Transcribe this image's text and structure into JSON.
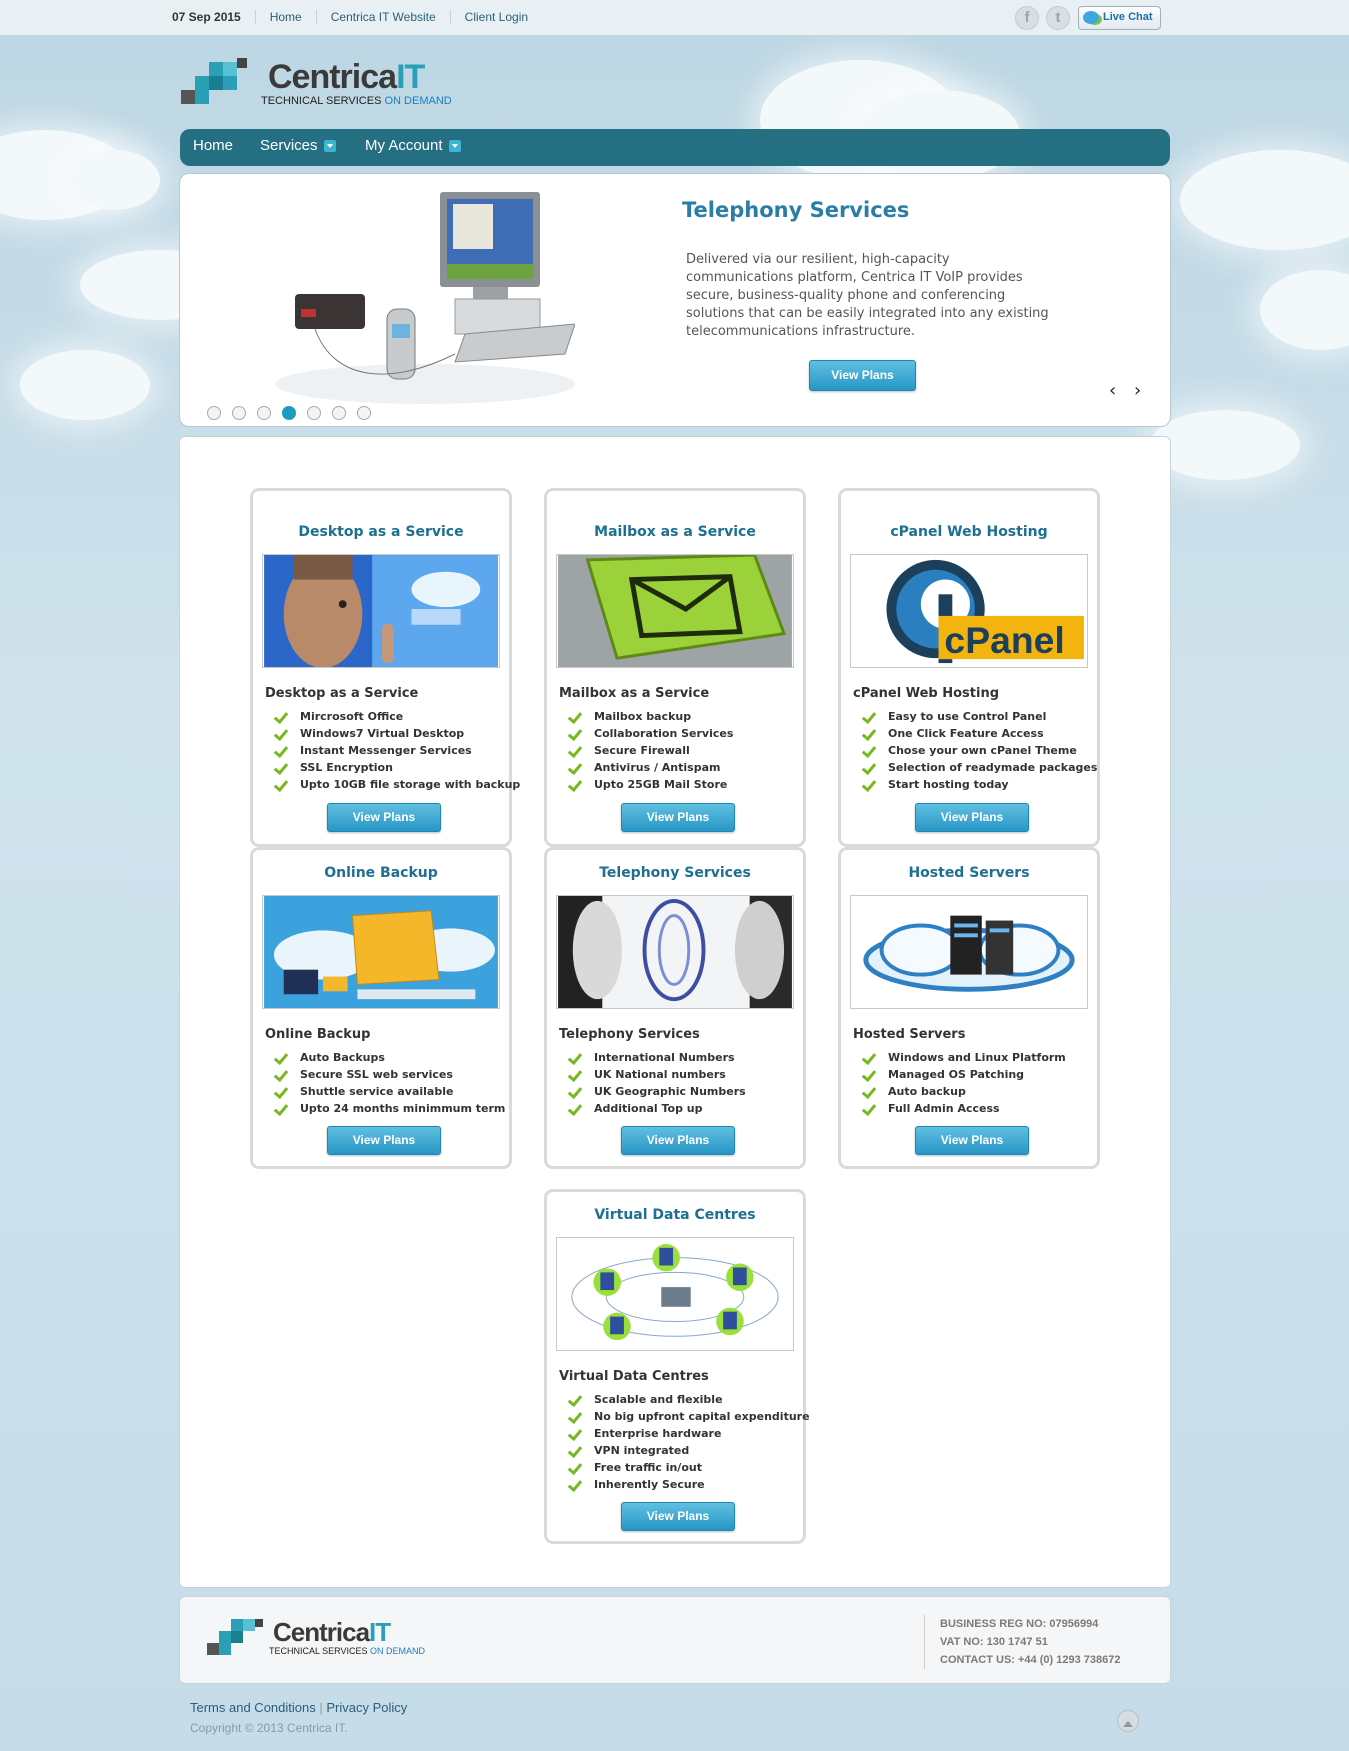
{
  "topbar": {
    "date": "07 Sep 2015",
    "links": [
      "Home",
      "Centrica IT Website",
      "Client Login"
    ],
    "social_icons": [
      "facebook-icon",
      "twitter-icon"
    ],
    "live_chat": "Live Chat"
  },
  "logo": {
    "brand_main": "Centrica",
    "brand_accent": "IT",
    "tagline_main": "TECHNICAL SERVICES",
    "tagline_accent": "ON DEMAND"
  },
  "nav": {
    "home": "Home",
    "services": "Services",
    "account": "My Account"
  },
  "slider": {
    "title": "Telephony Services",
    "text": "Delivered via our resilient, high-capacity communications platform, Centrica IT VoIP provides secure, business-quality phone and conferencing solutions that can be easily integrated into any existing telecommunications infrastructure.",
    "button": "View Plans",
    "prev": "‹",
    "next": "›",
    "slide_count": 7,
    "active_slide": 4
  },
  "cards": [
    {
      "title": "Desktop as a Service",
      "subtitle": "Desktop as a Service",
      "features": [
        "Mircrosoft Office",
        "Windows7 Virtual Desktop",
        "Instant Messenger Services",
        "SSL Encryption",
        "Upto 10GB file storage with backup"
      ],
      "button": "View Plans"
    },
    {
      "title": "Mailbox as a Service",
      "subtitle": "Mailbox as a Service",
      "features": [
        "Mailbox backup",
        "Collaboration Services",
        "Secure Firewall",
        "Antivirus / Antispam",
        "Upto 25GB Mail Store"
      ],
      "button": "View Plans"
    },
    {
      "title": "cPanel Web Hosting",
      "subtitle": "cPanel Web Hosting",
      "image_text": "cPanel",
      "features": [
        "Easy to use Control Panel",
        "One Click Feature Access",
        "Chose your own cPanel Theme",
        "Selection of readymade packages",
        "Start hosting today"
      ],
      "button": "View Plans"
    },
    {
      "title": "Online Backup",
      "subtitle": "Online Backup",
      "features": [
        "Auto Backups",
        "Secure SSL web services",
        "Shuttle service available",
        "Upto 24 months minimmum term"
      ],
      "button": "View Plans"
    },
    {
      "title": "Telephony Services",
      "subtitle": "Telephony Services",
      "features": [
        "International Numbers",
        "UK National numbers",
        "UK Geographic Numbers",
        "Additional Top up"
      ],
      "button": "View Plans"
    },
    {
      "title": "Hosted Servers",
      "subtitle": "Hosted Servers",
      "features": [
        "Windows and Linux Platform",
        "Managed OS Patching",
        "Auto backup",
        "Full Admin Access"
      ],
      "button": "View Plans"
    },
    {
      "title": "Virtual Data Centres",
      "subtitle": "Virtual Data Centres",
      "features": [
        "Scalable and flexible",
        "No big upfront capital expenditure",
        "Enterprise hardware",
        "VPN integrated",
        "Free traffic in/out",
        "Inherently Secure"
      ],
      "button": "View Plans"
    }
  ],
  "footer": {
    "reg": "BUSINESS REG NO: 07956994",
    "vat": "VAT NO: 130 1747 51",
    "contact": "CONTACT US: +44 (0) 1293 738672",
    "terms": "Terms and Conditions",
    "sep": "|",
    "privacy": "Privacy Policy",
    "copyright": "Copyright © 2013 Centrica IT."
  },
  "colors": {
    "nav": "#256f82",
    "accent": "#2a7da7",
    "button": "#2897c6",
    "check": "#78b81e"
  }
}
